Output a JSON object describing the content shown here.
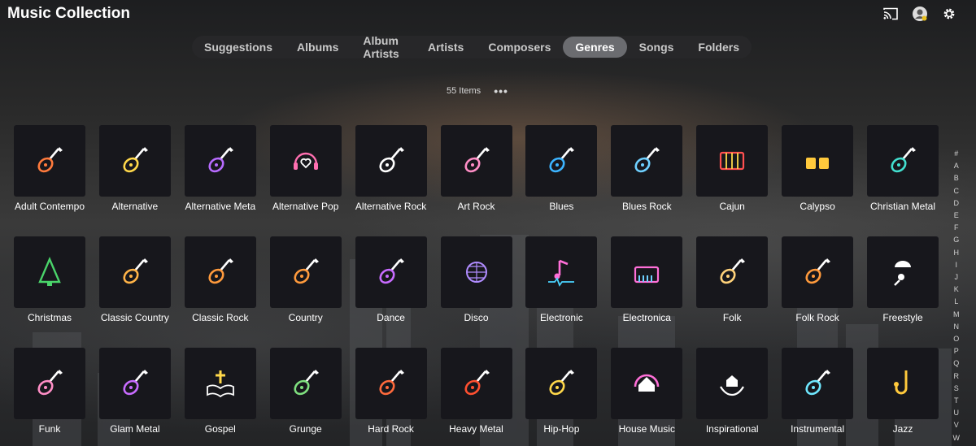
{
  "app": {
    "title": "Music Collection"
  },
  "header_icons": [
    "cast-icon",
    "user-avatar-icon",
    "settings-gear-icon"
  ],
  "tabs": [
    {
      "label": "Suggestions",
      "active": false
    },
    {
      "label": "Albums",
      "active": false
    },
    {
      "label": "Album Artists",
      "active": false
    },
    {
      "label": "Artists",
      "active": false
    },
    {
      "label": "Composers",
      "active": false
    },
    {
      "label": "Genres",
      "active": true
    },
    {
      "label": "Songs",
      "active": false
    },
    {
      "label": "Folders",
      "active": false
    }
  ],
  "items_count": "55 Items",
  "more_label": "•••",
  "genres": [
    {
      "label": "Adult Contempo",
      "icon": "guitar-sunset-icon",
      "color": "#ff7a3c"
    },
    {
      "label": "Alternative",
      "icon": "electric-guitar-icon",
      "color": "#ffd84a"
    },
    {
      "label": "Alternative Meta",
      "icon": "flaming-guitar-icon",
      "color": "#b86bff"
    },
    {
      "label": "Alternative Pop",
      "icon": "headphones-heart-icon",
      "color": "#ff6fb0"
    },
    {
      "label": "Alternative Rock",
      "icon": "guitar-lightning-icon",
      "color": "#ffffff"
    },
    {
      "label": "Art Rock",
      "icon": "guitar-palette-icon",
      "color": "#ff8ec6"
    },
    {
      "label": "Blues",
      "icon": "acoustic-guitar-wave-icon",
      "color": "#3cb4ff"
    },
    {
      "label": "Blues Rock",
      "icon": "guitar-notes-icon",
      "color": "#6fd0ff"
    },
    {
      "label": "Cajun",
      "icon": "accordion-icon",
      "color": "#ff5050"
    },
    {
      "label": "Calypso",
      "icon": "steel-drums-icon",
      "color": "#ffc93c"
    },
    {
      "label": "Christian Metal",
      "icon": "guitar-cross-icon",
      "color": "#42e0d0"
    },
    {
      "label": "Christmas",
      "icon": "christmas-tree-icon",
      "color": "#4ad46a"
    },
    {
      "label": "Classic Country",
      "icon": "cowboy-guitar-icon",
      "color": "#ffb347"
    },
    {
      "label": "Classic Rock",
      "icon": "guitar-bolt-icon",
      "color": "#ff9a3c"
    },
    {
      "label": "Country",
      "icon": "acoustic-guitar-hat-icon",
      "color": "#ff9a3c"
    },
    {
      "label": "Dance",
      "icon": "disco-headphones-icon",
      "color": "#c86bff"
    },
    {
      "label": "Disco",
      "icon": "disco-ball-icon",
      "color": "#b08cff"
    },
    {
      "label": "Electronic",
      "icon": "music-note-pulse-icon",
      "color": "#ff6fd8"
    },
    {
      "label": "Electronica",
      "icon": "synthesizer-icon",
      "color": "#ff6fd8"
    },
    {
      "label": "Folk",
      "icon": "folk-guitar-icon",
      "color": "#ffd27a"
    },
    {
      "label": "Folk Rock",
      "icon": "guitar-leaf-icon",
      "color": "#ff9a3c"
    },
    {
      "label": "Freestyle",
      "icon": "microphone-cap-icon",
      "color": "#ffffff"
    },
    {
      "label": "Funk",
      "icon": "funk-guitar-disco-icon",
      "color": "#ff8ec6"
    },
    {
      "label": "Glam Metal",
      "icon": "glam-guitar-icon",
      "color": "#c86bff"
    },
    {
      "label": "Gospel",
      "icon": "bible-cross-icon",
      "color": "#ffd84a"
    },
    {
      "label": "Grunge",
      "icon": "grunge-guitar-icon",
      "color": "#7fe07f"
    },
    {
      "label": "Hard Rock",
      "icon": "flaming-guitar-hard-icon",
      "color": "#ff6a3c"
    },
    {
      "label": "Heavy Metal",
      "icon": "skull-guitar-icon",
      "color": "#ff5030"
    },
    {
      "label": "Hip-Hop",
      "icon": "cap-microphone-icon",
      "color": "#ffd84a"
    },
    {
      "label": "House Music",
      "icon": "house-headphones-icon",
      "color": "#ff6fd8"
    },
    {
      "label": "Inspirational",
      "icon": "hands-house-icon",
      "color": "#ffffff"
    },
    {
      "label": "Instrumental",
      "icon": "guitar-music-note-icon",
      "color": "#6fe8ff"
    },
    {
      "label": "Jazz",
      "icon": "saxophone-icon",
      "color": "#ffc93c"
    }
  ],
  "alphabet": [
    "#",
    "A",
    "B",
    "C",
    "D",
    "E",
    "F",
    "G",
    "H",
    "I",
    "J",
    "K",
    "L",
    "M",
    "N",
    "O",
    "P",
    "Q",
    "R",
    "S",
    "T",
    "U",
    "V",
    "W"
  ]
}
